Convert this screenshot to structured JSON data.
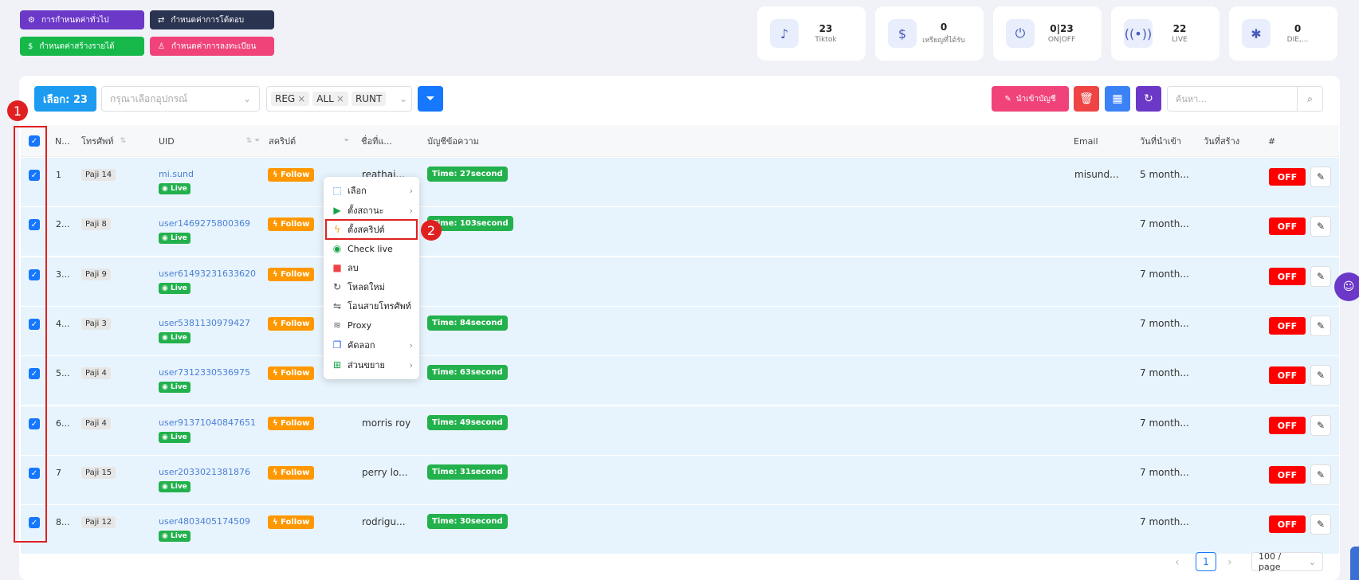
{
  "top_buttons": [
    {
      "label": "การกำหนดค่าทั่วไป",
      "color": "#6b38c8",
      "icon": "gear-icon"
    },
    {
      "label": "กำหนดค่าการโต้ตอบ",
      "color": "#2a3350",
      "icon": "swap-icon"
    },
    {
      "label": "กำหนดค่าสร้างรายได้",
      "color": "#16b84a",
      "icon": "dollar-icon"
    },
    {
      "label": "กำหนดค่าการลงทะเบียน",
      "color": "#f0437a",
      "icon": "user-add-icon"
    }
  ],
  "stats": [
    {
      "value": "23",
      "label": "Tiktok",
      "icon": "tiktok-icon"
    },
    {
      "value": "0",
      "label": "เหรียญที่ได้รับ",
      "icon": "coin-icon"
    },
    {
      "value": "0|23",
      "label": "ON|OFF",
      "icon": "power-icon"
    },
    {
      "value": "22",
      "label": "LIVE",
      "icon": "broadcast-icon"
    },
    {
      "value": "0",
      "label": "DIE,...",
      "icon": "bug-icon"
    }
  ],
  "toolbar": {
    "selected": "เลือก: 23",
    "device_placeholder": "กรุณาเลือกอุปกรณ์",
    "tags": [
      "REG",
      "ALL",
      "RUNT"
    ],
    "import_label": "นำเข้าบัญชี",
    "search_placeholder": "ค้นหา..."
  },
  "headers": {
    "no": "N...",
    "phone": "โทรศัพท์",
    "uid": "UID",
    "script": "สคริปต์",
    "name": "ชื่อที่แ...",
    "msg": "บัญชีข้อความ",
    "email": "Email",
    "imported": "วันที่นำเข้า",
    "created": "วันที่สร้าง",
    "hash": "#"
  },
  "rows": [
    {
      "no": "1",
      "phone": "Paji 14",
      "uid": "mi.sund",
      "live": "Live",
      "script": "Follow",
      "name": "reathai...",
      "time": "Time: 27second",
      "email": "misund...",
      "imported": "5 month...",
      "status": "OFF"
    },
    {
      "no": "2...",
      "phone": "Paji 8",
      "uid": "user1469275800369",
      "live": "Live",
      "script": "Follow",
      "name": "",
      "time": "Time: 103second",
      "email": "",
      "imported": "7 month...",
      "status": "OFF"
    },
    {
      "no": "3...",
      "phone": "Paji 9",
      "uid": "user61493231633620",
      "live": "Live",
      "script": "Follow",
      "name": "",
      "time": "",
      "email": "",
      "imported": "7 month...",
      "status": "OFF"
    },
    {
      "no": "4...",
      "phone": "Paji 3",
      "uid": "user5381130979427",
      "live": "Live",
      "script": "Follow",
      "name": "",
      "time": "Time: 84second",
      "email": "",
      "imported": "7 month...",
      "status": "OFF"
    },
    {
      "no": "5...",
      "phone": "Paji 4",
      "uid": "user7312330536975",
      "live": "Live",
      "script": "Follow",
      "name": "",
      "time": "Time: 63second",
      "email": "",
      "imported": "7 month...",
      "status": "OFF"
    },
    {
      "no": "6...",
      "phone": "Paji 4",
      "uid": "user91371040847651",
      "live": "Live",
      "script": "Follow",
      "name": "morris roy",
      "time": "Time: 49second",
      "email": "",
      "imported": "7 month...",
      "status": "OFF"
    },
    {
      "no": "7",
      "phone": "Paji 15",
      "uid": "user2033021381876",
      "live": "Live",
      "script": "Follow",
      "name": "perry lo...",
      "time": "Time: 31second",
      "email": "",
      "imported": "7 month...",
      "status": "OFF"
    },
    {
      "no": "8...",
      "phone": "Paji 12",
      "uid": "user4803405174509",
      "live": "Live",
      "script": "Follow",
      "name": "rodrigu...",
      "time": "Time: 30second",
      "email": "",
      "imported": "7 month...",
      "status": "OFF"
    }
  ],
  "context_menu": [
    {
      "label": "เลือก",
      "icon": "cursor-select-icon",
      "submenu": true
    },
    {
      "label": "ตั้งสถานะ",
      "icon": "play-circle-icon",
      "submenu": true
    },
    {
      "label": "ตั้งสคริปต์",
      "icon": "lightning-icon",
      "submenu": false
    },
    {
      "label": "Check live",
      "icon": "eye-icon",
      "submenu": false
    },
    {
      "label": "ลบ",
      "icon": "trash-icon",
      "submenu": false
    },
    {
      "label": "โหลดใหม่",
      "icon": "reload-icon",
      "submenu": false
    },
    {
      "label": "โอนสายโทรศัพท์",
      "icon": "transfer-icon",
      "submenu": false
    },
    {
      "label": "Proxy",
      "icon": "wifi-icon",
      "submenu": false
    },
    {
      "label": "คัดลอก",
      "icon": "copy-icon",
      "submenu": true
    },
    {
      "label": "ส่วนขยาย",
      "icon": "extension-icon",
      "submenu": true
    }
  ],
  "annotations": {
    "one": "1",
    "two": "2"
  },
  "pagination": {
    "page": "1",
    "per_page": "100 / page"
  }
}
